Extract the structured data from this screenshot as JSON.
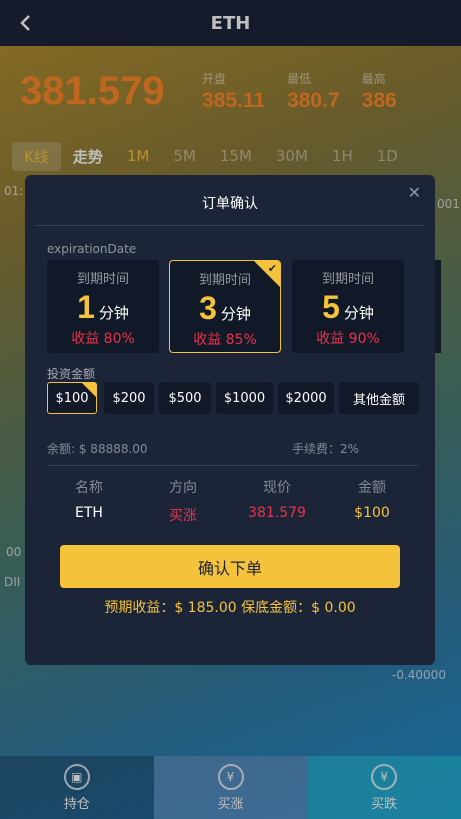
{
  "header": {
    "title": "ETH"
  },
  "price": {
    "current": "381.579",
    "open_label": "开盘",
    "open": "385.11",
    "low_label": "最低",
    "low": "380.7",
    "high_label": "最高",
    "high": "386"
  },
  "chart_tabs": [
    "K线",
    "走势",
    "1M",
    "5M",
    "15M",
    "30M",
    "1H",
    "1D"
  ],
  "background_fragments": {
    "left_time": "01:",
    "left_mid": "00",
    "left_dii": "DII",
    "right_value": "-0.40000",
    "right_top": "001"
  },
  "modal": {
    "title": "订单确认",
    "expiration_label": "expirationDate",
    "cards": [
      {
        "title": "到期时间",
        "num": "1",
        "unit": "分钟",
        "rate_label": "收益",
        "rate": "80%",
        "selected": false
      },
      {
        "title": "到期时间",
        "num": "3",
        "unit": "分钟",
        "rate_label": "收益",
        "rate": "85%",
        "selected": true
      },
      {
        "title": "到期时间",
        "num": "5",
        "unit": "分钟",
        "rate_label": "收益",
        "rate": "90%",
        "selected": false
      }
    ],
    "amount_label": "投资金额",
    "amounts": [
      "$100",
      "$200",
      "$500",
      "$1000",
      "$2000",
      "其他金额"
    ],
    "balance": "余额: $ 88888.00",
    "fee": "手续费：2%",
    "columns": [
      "名称",
      "方向",
      "现价",
      "金额"
    ],
    "row": [
      "ETH",
      "买涨",
      "381.579",
      "$100"
    ],
    "confirm_label": "确认下单",
    "expected": "预期收益：$ 185.00    保底金额：$ 0.00"
  },
  "bottom_nav": [
    {
      "label": "持仓",
      "icon": "wallet-icon"
    },
    {
      "label": "买涨",
      "icon": "yen-coin-icon"
    },
    {
      "label": "买跌",
      "icon": "yen-coin-icon"
    }
  ],
  "colors": {
    "accent": "#f5c23b",
    "price": "#ff8a2a",
    "red": "#e8334a",
    "panel": "#1c2538"
  }
}
